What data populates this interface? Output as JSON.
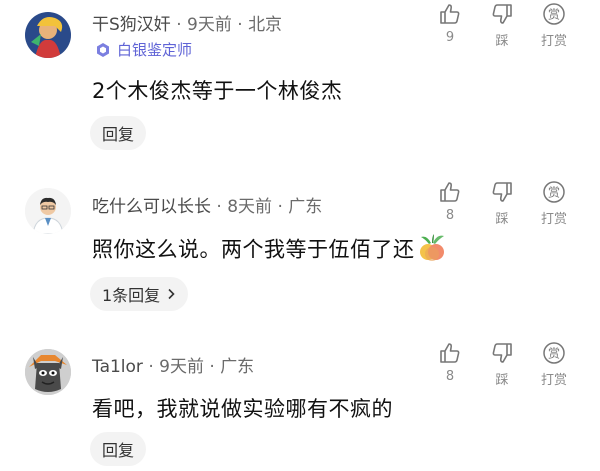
{
  "comments": [
    {
      "username": "干S狗汉奸",
      "time": "9天前",
      "location": "北京",
      "badge": "白银鉴定师",
      "text": "2个木俊杰等于一个林俊杰",
      "reply_label": "回复",
      "like_count": "9",
      "dislike_label": "踩",
      "tip_label": "打赏",
      "tip_icon_char": "赏"
    },
    {
      "username": "吃什么可以长长",
      "time": "8天前",
      "location": "广东",
      "text": "照你这么说。两个我等于伍佰了还",
      "reply_label": "1条回复",
      "like_count": "8",
      "dislike_label": "踩",
      "tip_label": "打赏",
      "tip_icon_char": "赏"
    },
    {
      "username": "Ta1lor",
      "time": "9天前",
      "location": "广东",
      "text": "看吧，我就说做实验哪有不疯的",
      "reply_label": "回复",
      "like_count": "8",
      "dislike_label": "踩",
      "tip_label": "打赏",
      "tip_icon_char": "赏"
    }
  ],
  "separator": " · ",
  "colors": {
    "badge": "#5f63d6",
    "meta": "#6b6b6b",
    "reply_bg": "#f3f3f3"
  }
}
